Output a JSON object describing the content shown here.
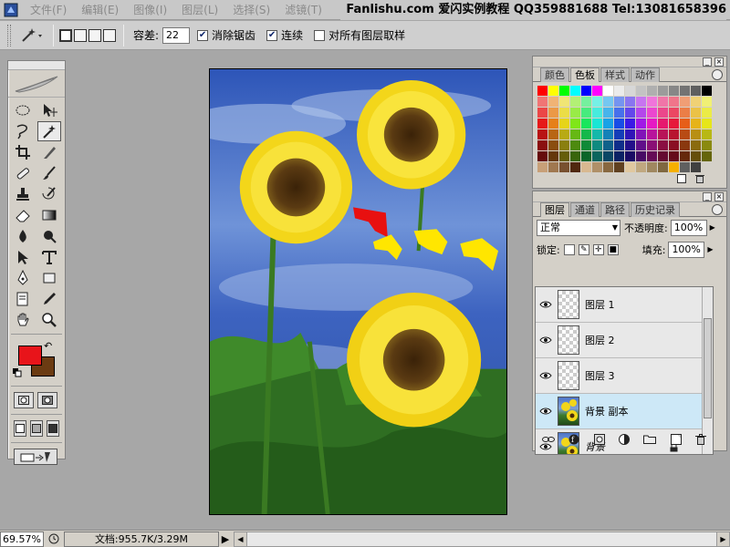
{
  "menubar": {
    "items": [
      "文件(F)",
      "编辑(E)",
      "图像(I)",
      "图层(L)",
      "选择(S)",
      "滤镜(T)"
    ],
    "overlay_title": "Fanlishu.com 爱闪实例教程 QQ359881688 Tel:13081658396"
  },
  "options": {
    "tolerance_label": "容差:",
    "tolerance_value": "22",
    "antialias_label": "消除锯齿",
    "antialias_checked": true,
    "contiguous_label": "连续",
    "contiguous_checked": true,
    "sample_all_label": "对所有图层取样",
    "sample_all_checked": false
  },
  "toolbox": {
    "foreground_color": "#e8141a",
    "background_color": "#6b3b12"
  },
  "swatches_palette": {
    "tabs": [
      "颜色",
      "色板",
      "样式",
      "动作"
    ],
    "active_tab": "色板"
  },
  "layers_palette": {
    "tabs": [
      "图层",
      "通道",
      "路径",
      "历史记录"
    ],
    "active_tab": "图层",
    "blend_mode": "正常",
    "opacity_label": "不透明度:",
    "opacity_value": "100%",
    "lock_label": "锁定:",
    "fill_label": "填充:",
    "fill_value": "100%",
    "layers": [
      {
        "name": "图层 1",
        "thumb": "transparent",
        "selected": false,
        "italic": false,
        "locked": false
      },
      {
        "name": "图层 2",
        "thumb": "transparent",
        "selected": false,
        "italic": false,
        "locked": false
      },
      {
        "name": "图层 3",
        "thumb": "transparent",
        "selected": false,
        "italic": false,
        "locked": false
      },
      {
        "name": "背景 副本",
        "thumb": "photo",
        "selected": true,
        "italic": false,
        "locked": false
      },
      {
        "name": "背景",
        "thumb": "photo",
        "selected": false,
        "italic": true,
        "locked": true
      }
    ]
  },
  "statusbar": {
    "zoom": "69.57%",
    "doc_size": "文档:955.7K/3.29M"
  }
}
